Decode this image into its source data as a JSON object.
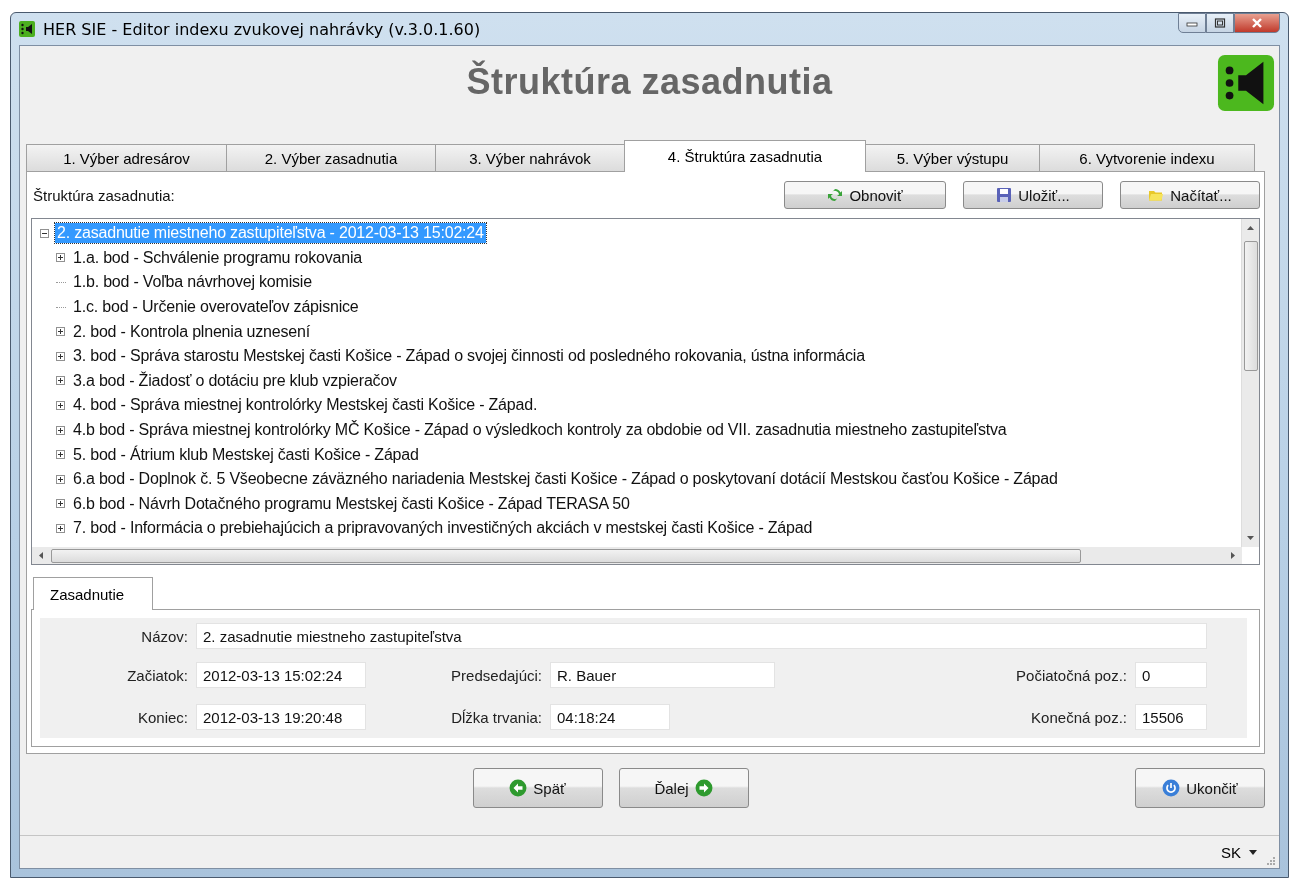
{
  "window": {
    "title": "HER SIE - Editor indexu zvukovej nahrávky (v.3.0.1.60)"
  },
  "heading": "Štruktúra zasadnutia",
  "tabs": [
    {
      "label": "1. Výber adresárov",
      "selected": false
    },
    {
      "label": "2. Výber zasadnutia",
      "selected": false
    },
    {
      "label": "3. Výber nahrávok",
      "selected": false
    },
    {
      "label": "4. Štruktúra zasadnutia",
      "selected": true
    },
    {
      "label": "5. Výber výstupu",
      "selected": false
    },
    {
      "label": "6. Vytvorenie indexu",
      "selected": false
    }
  ],
  "structure_label": "Štruktúra zasadnutia:",
  "toolbar_buttons": [
    {
      "kind": "refresh",
      "label": "Obnoviť"
    },
    {
      "kind": "save",
      "label": "Uložiť..."
    },
    {
      "kind": "open",
      "label": "Načítať..."
    }
  ],
  "tree": {
    "label": "2. zasadnutie miestneho zastupiteľstva - 2012-03-13 15:02:24",
    "expanded": true,
    "selected": true,
    "children": [
      {
        "label": "1.a. bod - Schválenie programu rokovania",
        "kind": "branch",
        "selected": false
      },
      {
        "label": "1.b. bod - Voľba návrhovej komisie",
        "kind": "leaf",
        "selected": false
      },
      {
        "label": "1.c. bod - Určenie overovateľov zápisnice",
        "kind": "leaf",
        "selected": false
      },
      {
        "label": "2. bod - Kontrola plnenia uznesení",
        "kind": "branch",
        "selected": false
      },
      {
        "label": "3. bod - Správa starostu Mestskej časti Košice - Západ o svojej činnosti od posledného rokovania, ústna informácia",
        "kind": "branch",
        "selected": false
      },
      {
        "label": "3.a bod - Žiadosť o dotáciu pre klub vzpieračov",
        "kind": "branch",
        "selected": false
      },
      {
        "label": "4. bod - Správa miestnej kontrolórky Mestskej časti  Košice - Západ.",
        "kind": "branch",
        "selected": false
      },
      {
        "label": "4.b bod - Správa miestnej kontrolórky MČ Košice - Západ o výsledkoch kontroly za obdobie od VII. zasadnutia miestneho zastupiteľstva",
        "kind": "branch",
        "selected": false
      },
      {
        "label": "5. bod - Átrium klub Mestskej časti Košice - Západ",
        "kind": "branch",
        "selected": false
      },
      {
        "label": "6.a bod - Doplnok č. 5 Všeobecne záväzného nariadenia Mestskej časti Košice - Západ o poskytovaní dotácií Mestskou časťou  Košice - Západ",
        "kind": "branch",
        "selected": false
      },
      {
        "label": "6.b bod - Návrh Dotačného programu Mestskej časti Košice - Západ TERASA 50",
        "kind": "branch",
        "selected": false
      },
      {
        "label": "7. bod - Informácia o prebiehajúcich a pripravovaných investičných akciách v mestskej časti Košice - Západ",
        "kind": "branch",
        "selected": false
      }
    ]
  },
  "detail_tab": {
    "label": "Zasadnutie"
  },
  "details": {
    "name": {
      "label": "Názov:",
      "value": "2. zasadnutie miestneho zastupiteľstva"
    },
    "start": {
      "label": "Začiatok:",
      "value": "2012-03-13 15:02:24"
    },
    "end": {
      "label": "Koniec:",
      "value": "2012-03-13 19:20:48"
    },
    "chair": {
      "label": "Predsedajúci:",
      "value": "R. Bauer"
    },
    "duration": {
      "label": "Dĺžka trvania:",
      "value": "04:18:24"
    },
    "start_pos": {
      "label": "Počiatočná poz.:",
      "value": "0"
    },
    "end_pos": {
      "label": "Konečná poz.:",
      "value": "15506"
    }
  },
  "nav_buttons": [
    {
      "kind": "back",
      "label": "Späť"
    },
    {
      "kind": "next",
      "label": "Ďalej"
    }
  ],
  "exit_button": {
    "label": "Ukončiť"
  },
  "status_bar": {
    "language": "SK"
  }
}
